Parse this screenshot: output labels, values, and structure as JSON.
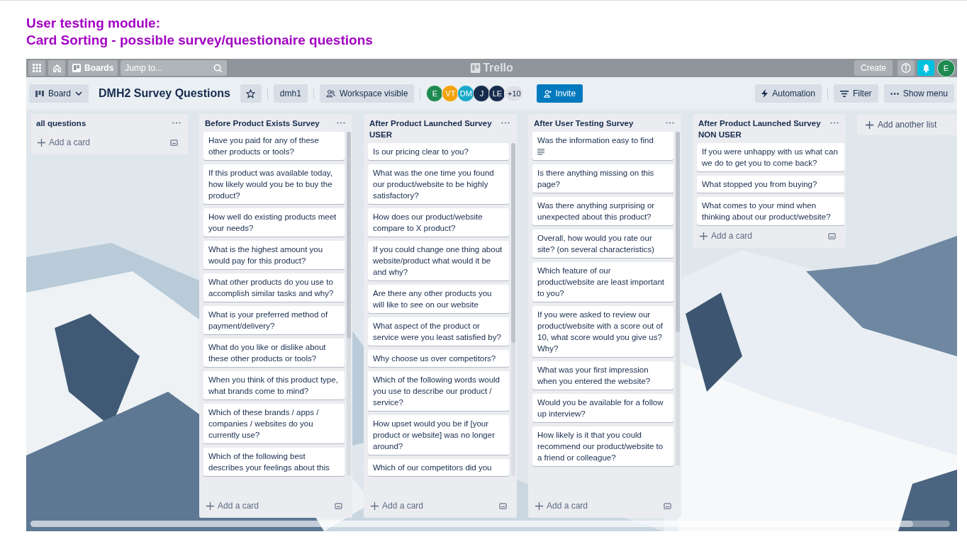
{
  "heading": [
    "User testing module:",
    "Card Sorting - possible survey/questionaire questions"
  ],
  "top_bar": {
    "boards": "Boards",
    "search": {
      "placeholder": "Jump to..."
    },
    "logo": "Trello",
    "create": "Create",
    "avatar": {
      "initials": "E",
      "color": "#1f8a50"
    }
  },
  "board_header": {
    "view": "Board",
    "title": "DMH2 Survey Questions",
    "starred": false,
    "workspace": "dmh1",
    "visibility": "Workspace visible",
    "members": [
      {
        "initials": "E",
        "color": "#1f8a50"
      },
      {
        "initials": "VT",
        "color": "#f2a20c"
      },
      {
        "initials": "DM",
        "color": "#18a9c9"
      },
      {
        "initials": "J",
        "color": "#172b4d"
      },
      {
        "initials": "LE",
        "color": "#172b4d"
      }
    ],
    "more_members": "+10",
    "invite": "Invite",
    "automation": "Automation",
    "filter": "Filter",
    "menu": "Show menu"
  },
  "lists": [
    {
      "title": "all questions",
      "add_card": "Add a card"
    },
    {
      "title": "Before Product Exists Survey",
      "add_card": "Add a card",
      "cards": [
        {
          "text": "Have you paid for any of these other products or tools?",
          "has_description": false
        },
        {
          "text": "If this product was available today, how likely would you be to buy the product?",
          "has_description": false
        },
        {
          "text": "How well do existing products meet your needs?",
          "has_description": false
        },
        {
          "text": "What is the highest amount you would pay for this product?",
          "has_description": false
        },
        {
          "text": "What other products do you use to accomplish similar tasks and why?",
          "has_description": false
        },
        {
          "text": "What is your preferred method of payment/delivery?",
          "has_description": false
        },
        {
          "text": "What do you like or dislike about these other products or tools?",
          "has_description": false
        },
        {
          "text": "When you think of this product type, what brands come to mind?",
          "has_description": false
        },
        {
          "text": "Which of these brands / apps / companies / websites do you currently use?",
          "has_description": false
        },
        {
          "text": "Which of the following best describes your feelings about this",
          "has_description": false
        }
      ]
    },
    {
      "title": "After Product Launched Survey USER",
      "add_card": "Add a card",
      "cards": [
        {
          "text": "Is our pricing clear to you?",
          "has_description": false
        },
        {
          "text": "What was the one time you found our product/website to be highly satisfactory?",
          "has_description": false
        },
        {
          "text": "How does our product/website compare to X product?",
          "has_description": false
        },
        {
          "text": "If you could change one thing about website/product what would it be and why?",
          "has_description": false
        },
        {
          "text": "Are there any other products you will like to see on our website",
          "has_description": false
        },
        {
          "text": "What aspect of the product or service were you least satisfied by?",
          "has_description": false
        },
        {
          "text": "Why choose us over competitors?",
          "has_description": false
        },
        {
          "text": "Which of the following words would you use to describe our product / service?",
          "has_description": false
        },
        {
          "text": "How upset would you be if [your product or website] was no longer around?",
          "has_description": false
        },
        {
          "text": "Which of our competitors did you",
          "has_description": false
        }
      ]
    },
    {
      "title": "After User Testing Survey",
      "add_card": "Add a card",
      "cards": [
        {
          "text": "Was the information easy to find",
          "has_description": true
        },
        {
          "text": "Is there anything missing on this page?",
          "has_description": false
        },
        {
          "text": "Was there anything surprising or unexpected about this product?",
          "has_description": false
        },
        {
          "text": "Overall, how would you rate our site? (on several characteristics)",
          "has_description": false
        },
        {
          "text": "Which feature of our product/website are least important to you?",
          "has_description": false
        },
        {
          "text": "If you were asked to review our product/website with a score out of 10, what score would you give us? Why?",
          "has_description": false
        },
        {
          "text": "What was your first impression when you entered the website?",
          "has_description": false
        },
        {
          "text": "Would you be available for a follow up interview?",
          "has_description": false
        },
        {
          "text": "How likely is it that you could recommend our product/website to a friend or colleague?",
          "has_description": false
        }
      ]
    },
    {
      "title": "After Product Launched Survey NON USER",
      "add_card": "Add a card",
      "cards": [
        {
          "text": "If you were unhappy with us what can we do to get you to come back?",
          "has_description": false
        },
        {
          "text": "What stopped you from buying?",
          "has_description": false
        },
        {
          "text": "What comes to your mind when thinking about our product/website?",
          "has_description": false
        }
      ]
    }
  ],
  "add_list": "Add another list"
}
